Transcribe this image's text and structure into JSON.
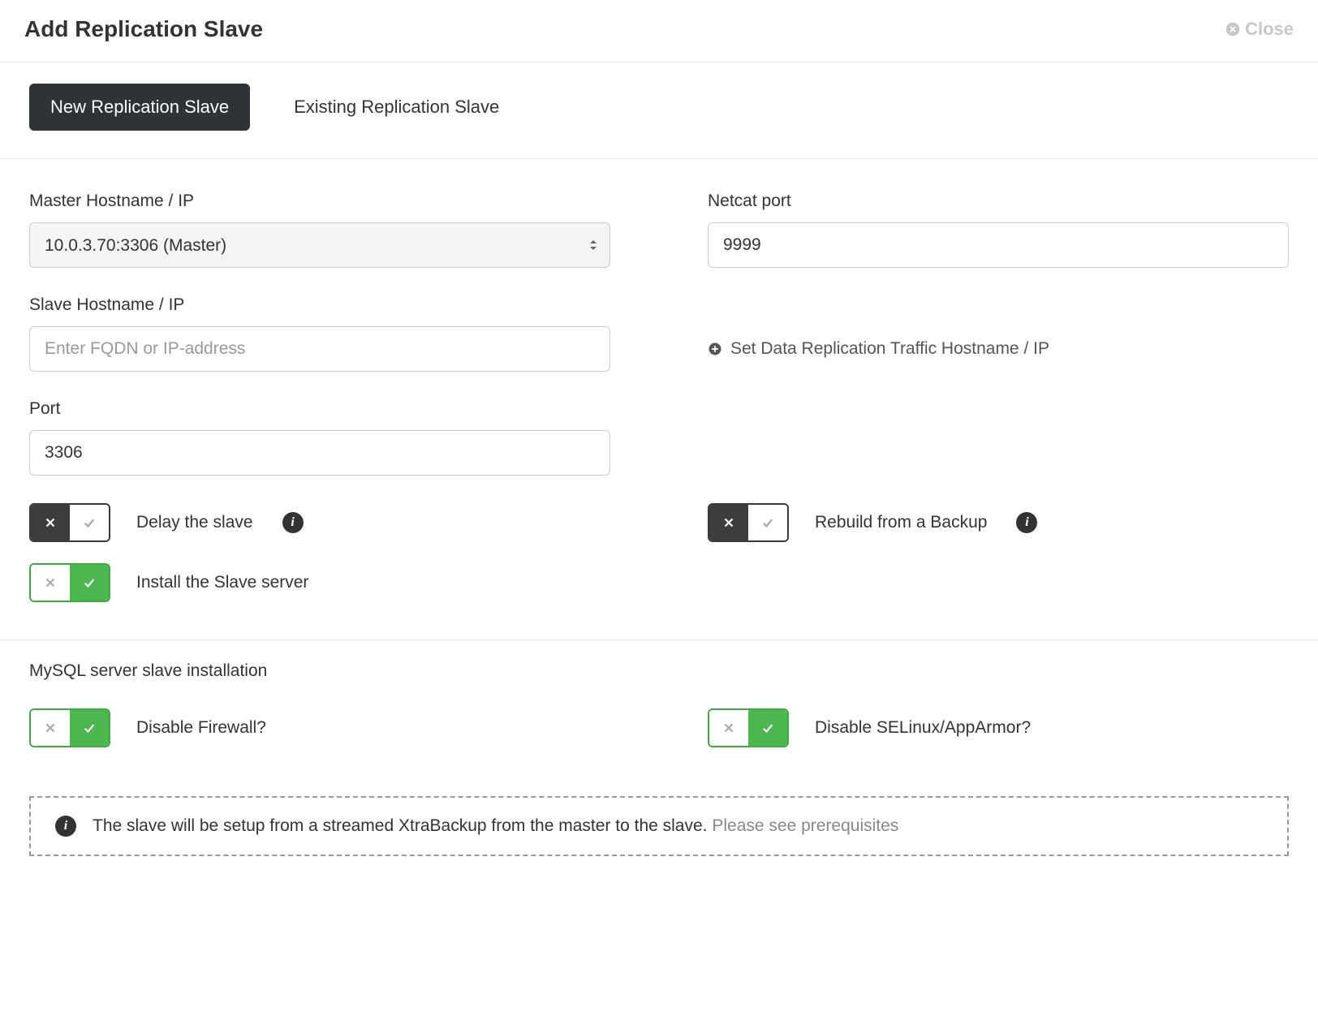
{
  "header": {
    "title": "Add Replication Slave",
    "close": "Close"
  },
  "tabs": {
    "new": "New Replication Slave",
    "existing": "Existing Replication Slave"
  },
  "form": {
    "master_label": "Master Hostname / IP",
    "master_value": "10.0.3.70:3306 (Master)",
    "netcat_label": "Netcat port",
    "netcat_value": "9999",
    "slave_label": "Slave Hostname / IP",
    "slave_placeholder": "Enter FQDN or IP-address",
    "set_data_rep": "Set Data Replication Traffic Hostname / IP",
    "port_label": "Port",
    "port_value": "3306",
    "delay_label": "Delay the slave",
    "rebuild_label": "Rebuild from a Backup",
    "install_label": "Install the Slave server"
  },
  "install_section": {
    "title": "MySQL server slave installation",
    "disable_firewall": "Disable Firewall?",
    "disable_selinux": "Disable SELinux/AppArmor?"
  },
  "notice": {
    "text": "The slave will be setup from a streamed XtraBackup from the master to the slave. ",
    "link": "Please see prerequisites"
  }
}
